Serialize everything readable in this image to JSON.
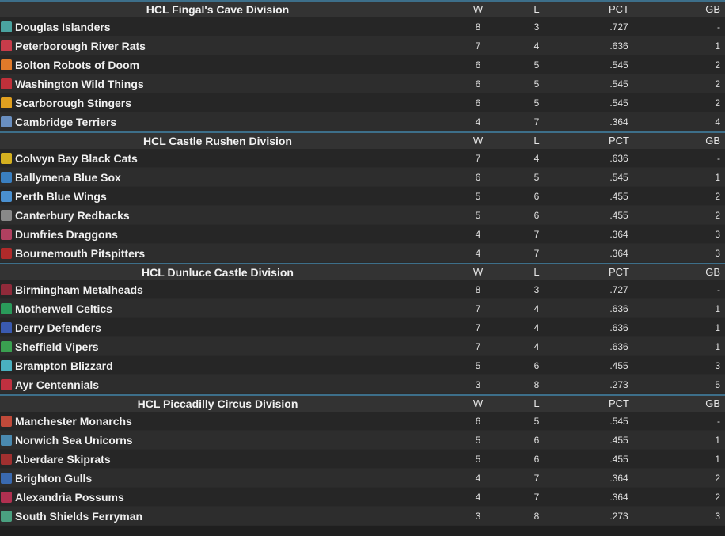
{
  "columns": {
    "w": "W",
    "l": "L",
    "pct": "PCT",
    "gb": "GB"
  },
  "divisions": [
    {
      "name": "HCL Fingal's Cave Division",
      "teams": [
        {
          "name": "Douglas Islanders",
          "w": "8",
          "l": "3",
          "pct": ".727",
          "gb": "-",
          "logo_color": "#4aa3a0"
        },
        {
          "name": "Peterborough River Rats",
          "w": "7",
          "l": "4",
          "pct": ".636",
          "gb": "1",
          "logo_color": "#c73c4a"
        },
        {
          "name": "Bolton Robots of Doom",
          "w": "6",
          "l": "5",
          "pct": ".545",
          "gb": "2",
          "logo_color": "#e07a2a"
        },
        {
          "name": "Washington Wild Things",
          "w": "6",
          "l": "5",
          "pct": ".545",
          "gb": "2",
          "logo_color": "#c0303a"
        },
        {
          "name": "Scarborough Stingers",
          "w": "6",
          "l": "5",
          "pct": ".545",
          "gb": "2",
          "logo_color": "#e0a020"
        },
        {
          "name": "Cambridge Terriers",
          "w": "4",
          "l": "7",
          "pct": ".364",
          "gb": "4",
          "logo_color": "#6a8fc0"
        }
      ]
    },
    {
      "name": "HCL Castle Rushen Division",
      "teams": [
        {
          "name": "Colwyn Bay Black Cats",
          "w": "7",
          "l": "4",
          "pct": ".636",
          "gb": "-",
          "logo_color": "#d4b020"
        },
        {
          "name": "Ballymena Blue Sox",
          "w": "6",
          "l": "5",
          "pct": ".545",
          "gb": "1",
          "logo_color": "#3a7fc0"
        },
        {
          "name": "Perth Blue Wings",
          "w": "5",
          "l": "6",
          "pct": ".455",
          "gb": "2",
          "logo_color": "#4a90d0"
        },
        {
          "name": "Canterbury Redbacks",
          "w": "5",
          "l": "6",
          "pct": ".455",
          "gb": "2",
          "logo_color": "#888888"
        },
        {
          "name": "Dumfries Draggons",
          "w": "4",
          "l": "7",
          "pct": ".364",
          "gb": "3",
          "logo_color": "#b04060"
        },
        {
          "name": "Bournemouth Pitspitters",
          "w": "4",
          "l": "7",
          "pct": ".364",
          "gb": "3",
          "logo_color": "#b02a2a"
        }
      ]
    },
    {
      "name": "HCL Dunluce Castle Division",
      "teams": [
        {
          "name": "Birmingham Metalheads",
          "w": "8",
          "l": "3",
          "pct": ".727",
          "gb": "-",
          "logo_color": "#902a3a"
        },
        {
          "name": "Motherwell Celtics",
          "w": "7",
          "l": "4",
          "pct": ".636",
          "gb": "1",
          "logo_color": "#2a9a5a"
        },
        {
          "name": "Derry Defenders",
          "w": "7",
          "l": "4",
          "pct": ".636",
          "gb": "1",
          "logo_color": "#3a5ab0"
        },
        {
          "name": "Sheffield Vipers",
          "w": "7",
          "l": "4",
          "pct": ".636",
          "gb": "1",
          "logo_color": "#3aa050"
        },
        {
          "name": "Brampton Blizzard",
          "w": "5",
          "l": "6",
          "pct": ".455",
          "gb": "3",
          "logo_color": "#4ab0c0"
        },
        {
          "name": "Ayr Centennials",
          "w": "3",
          "l": "8",
          "pct": ".273",
          "gb": "5",
          "logo_color": "#c03040"
        }
      ]
    },
    {
      "name": "HCL Piccadilly Circus Division",
      "teams": [
        {
          "name": "Manchester Monarchs",
          "w": "6",
          "l": "5",
          "pct": ".545",
          "gb": "-",
          "logo_color": "#c04a3a"
        },
        {
          "name": "Norwich Sea Unicorns",
          "w": "5",
          "l": "6",
          "pct": ".455",
          "gb": "1",
          "logo_color": "#4a8ab0"
        },
        {
          "name": "Aberdare Skiprats",
          "w": "5",
          "l": "6",
          "pct": ".455",
          "gb": "1",
          "logo_color": "#a03030"
        },
        {
          "name": "Brighton Gulls",
          "w": "4",
          "l": "7",
          "pct": ".364",
          "gb": "2",
          "logo_color": "#3a6ab0"
        },
        {
          "name": "Alexandria Possums",
          "w": "4",
          "l": "7",
          "pct": ".364",
          "gb": "2",
          "logo_color": "#b03050"
        },
        {
          "name": "South Shields Ferryman",
          "w": "3",
          "l": "8",
          "pct": ".273",
          "gb": "3",
          "logo_color": "#4aa080"
        }
      ]
    }
  ]
}
